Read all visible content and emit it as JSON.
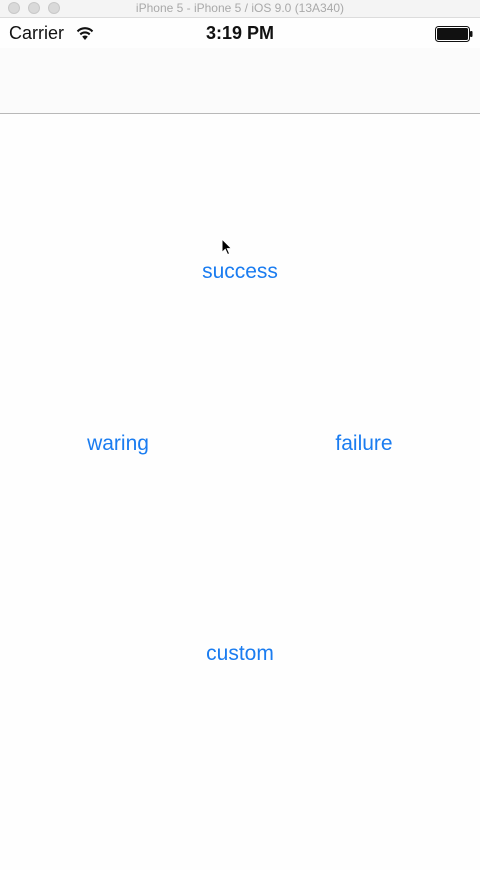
{
  "window": {
    "title": "iPhone 5 - iPhone 5 / iOS 9.0 (13A340)"
  },
  "status_bar": {
    "carrier": "Carrier",
    "time": "3:19 PM",
    "wifi_icon": "wifi-icon",
    "battery_icon": "battery-icon"
  },
  "buttons": {
    "success": "success",
    "waring": "waring",
    "failure": "failure",
    "custom": "custom"
  },
  "colors": {
    "accent": "#1a7cf0",
    "background": "#fefefe"
  }
}
